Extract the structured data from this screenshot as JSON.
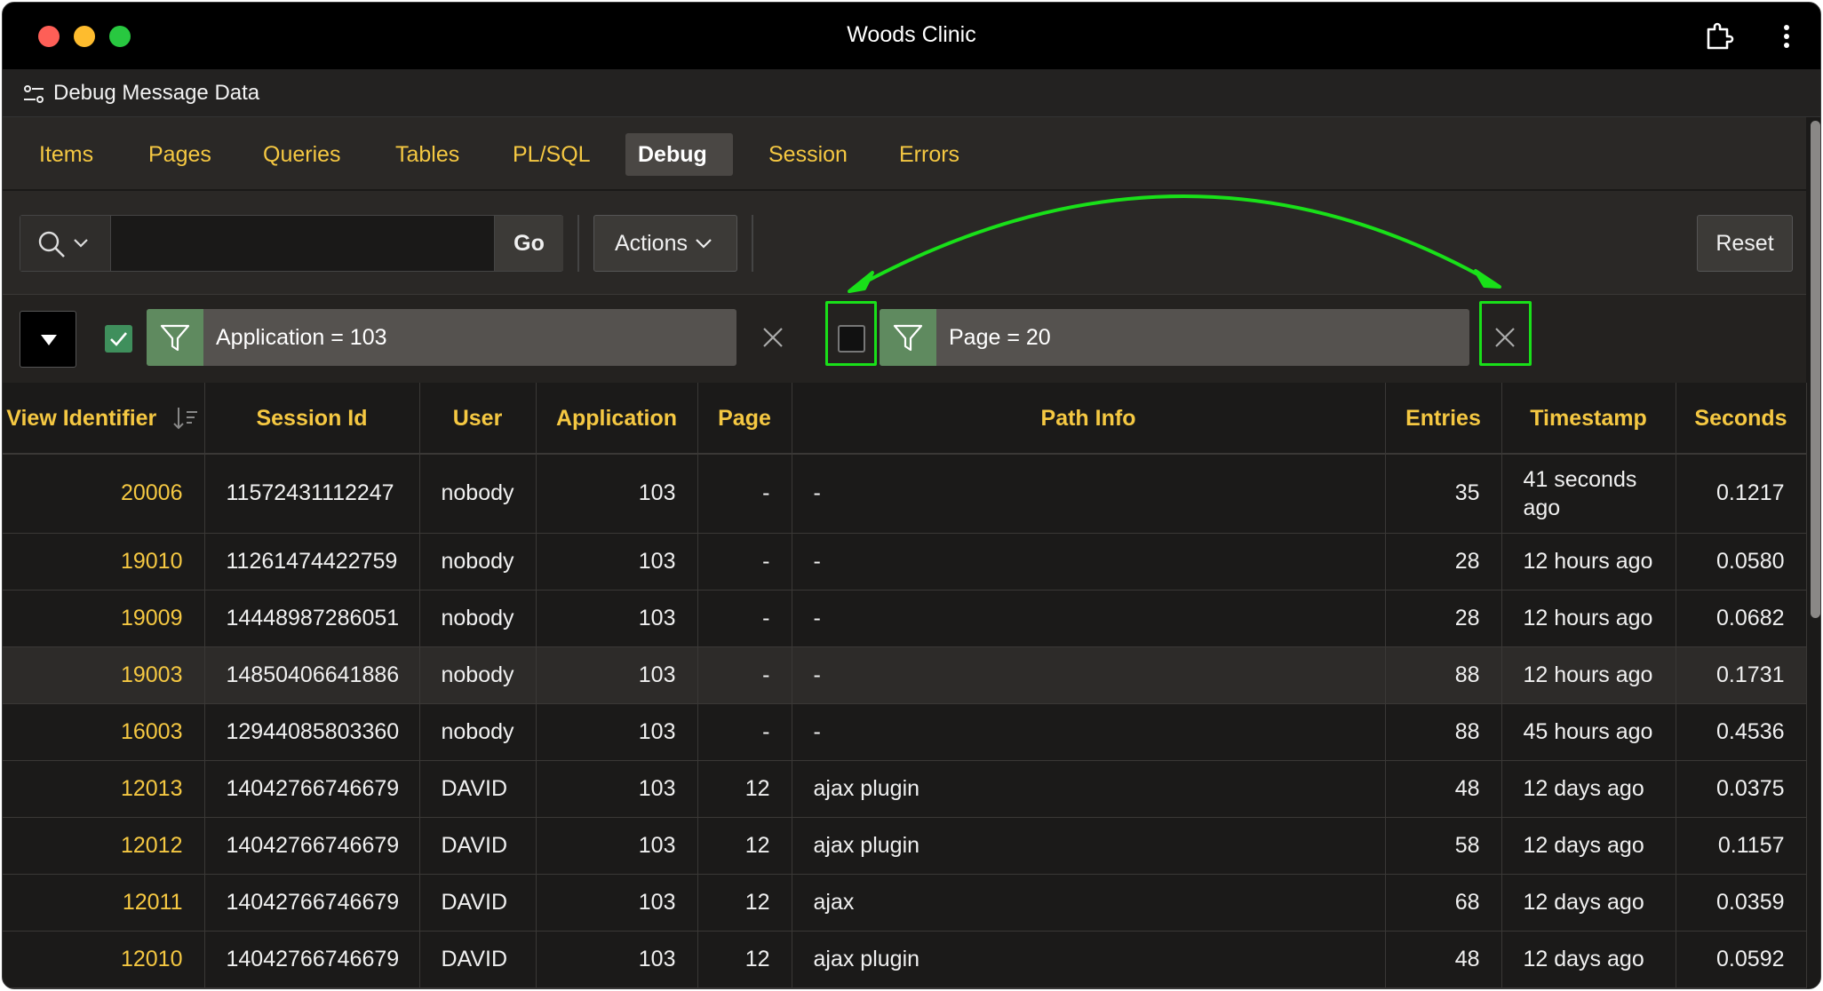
{
  "window": {
    "title": "Woods Clinic"
  },
  "dialog": {
    "title": "Debug Message Data"
  },
  "tabs": [
    {
      "label": "Items",
      "active": false
    },
    {
      "label": "Pages",
      "active": false
    },
    {
      "label": "Queries",
      "active": false
    },
    {
      "label": "Tables",
      "active": false
    },
    {
      "label": "PL/SQL",
      "active": false
    },
    {
      "label": "Debug",
      "active": true
    },
    {
      "label": "Session",
      "active": false
    },
    {
      "label": "Errors",
      "active": false
    }
  ],
  "toolbar": {
    "search_value": "",
    "go_label": "Go",
    "actions_label": "Actions",
    "reset_label": "Reset"
  },
  "filters": [
    {
      "text": "Application = 103",
      "enabled": true
    },
    {
      "text": "Page = 20",
      "enabled": false
    }
  ],
  "table": {
    "columns": [
      "View Identifier",
      "Session Id",
      "User",
      "Application",
      "Page",
      "Path Info",
      "Entries",
      "Timestamp",
      "Seconds"
    ],
    "rows": [
      {
        "view_id": "20006",
        "session_id": "11572431112247",
        "user": "nobody",
        "application": "103",
        "page": "-",
        "path_info": "-",
        "entries": "35",
        "timestamp": "41 seconds ago",
        "seconds": "0.1217"
      },
      {
        "view_id": "19010",
        "session_id": "11261474422759",
        "user": "nobody",
        "application": "103",
        "page": "-",
        "path_info": "-",
        "entries": "28",
        "timestamp": "12 hours ago",
        "seconds": "0.0580"
      },
      {
        "view_id": "19009",
        "session_id": "14448987286051",
        "user": "nobody",
        "application": "103",
        "page": "-",
        "path_info": "-",
        "entries": "28",
        "timestamp": "12 hours ago",
        "seconds": "0.0682"
      },
      {
        "view_id": "19003",
        "session_id": "14850406641886",
        "user": "nobody",
        "application": "103",
        "page": "-",
        "path_info": "-",
        "entries": "88",
        "timestamp": "12 hours ago",
        "seconds": "0.1731"
      },
      {
        "view_id": "16003",
        "session_id": "12944085803360",
        "user": "nobody",
        "application": "103",
        "page": "-",
        "path_info": "-",
        "entries": "88",
        "timestamp": "45 hours ago",
        "seconds": "0.4536"
      },
      {
        "view_id": "12013",
        "session_id": "14042766746679",
        "user": "DAVID",
        "application": "103",
        "page": "12",
        "path_info": "ajax plugin",
        "entries": "48",
        "timestamp": "12 days ago",
        "seconds": "0.0375"
      },
      {
        "view_id": "12012",
        "session_id": "14042766746679",
        "user": "DAVID",
        "application": "103",
        "page": "12",
        "path_info": "ajax plugin",
        "entries": "58",
        "timestamp": "12 days ago",
        "seconds": "0.1157"
      },
      {
        "view_id": "12011",
        "session_id": "14042766746679",
        "user": "DAVID",
        "application": "103",
        "page": "12",
        "path_info": "ajax",
        "entries": "68",
        "timestamp": "12 days ago",
        "seconds": "0.0359"
      },
      {
        "view_id": "12010",
        "session_id": "14042766746679",
        "user": "DAVID",
        "application": "103",
        "page": "12",
        "path_info": "ajax plugin",
        "entries": "48",
        "timestamp": "12 days ago",
        "seconds": "0.0592"
      }
    ]
  },
  "colors": {
    "accent": "#f5c842",
    "highlight": "#19e019",
    "filter_icon_bg": "#5f8a5f",
    "background": "#1b1a19"
  },
  "icons": {
    "titlebar": [
      "extension-icon",
      "more-vert-icon"
    ],
    "dialog": "settings-sliders-icon",
    "search": "search-icon",
    "filter": "funnel-icon",
    "remove": "close-icon",
    "sort": "sort-descending-icon"
  }
}
